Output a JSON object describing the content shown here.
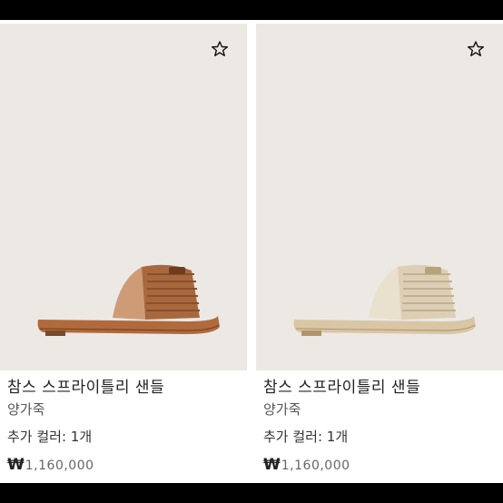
{
  "products": [
    {
      "name": "참스 스프라이틀리 샌들",
      "material": "양가죽",
      "colors_label": "추가 컬러: 1개",
      "currency": "₩",
      "price": "1,160,000",
      "image_alt": "brown woven raffia slide sandal",
      "colors": {
        "upper": "#a8683e",
        "sole": "#b06a3c"
      }
    },
    {
      "name": "참스 스프라이틀리 샌들",
      "material": "양가죽",
      "colors_label": "추가 컬러: 1개",
      "currency": "₩",
      "price": "1,160,000",
      "image_alt": "beige woven raffia slide sandal",
      "colors": {
        "upper": "#ddcfb6",
        "sole": "#d9c6a4"
      }
    }
  ],
  "icons": {
    "favorite": "star-outline-icon"
  },
  "theme": {
    "background": "#ece9e5",
    "bezel": "#000000"
  }
}
